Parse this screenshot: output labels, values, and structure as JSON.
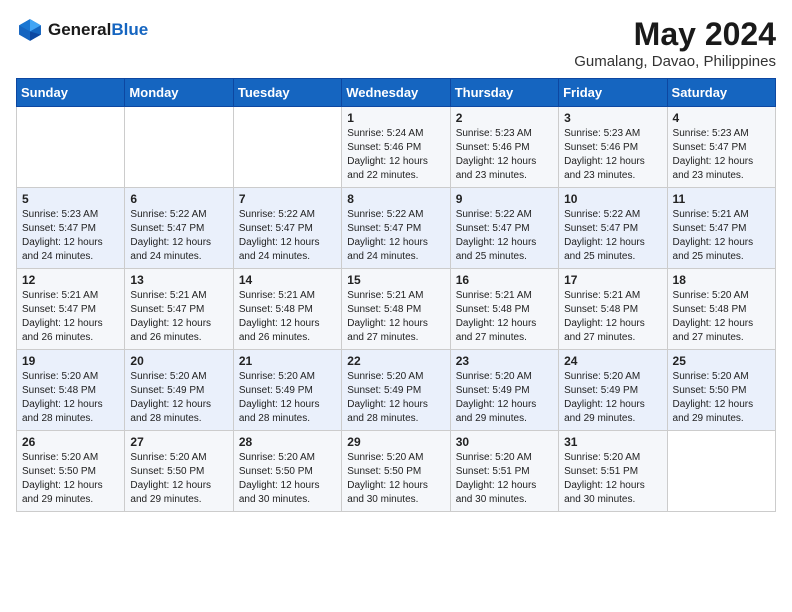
{
  "header": {
    "logo_general": "General",
    "logo_blue": "Blue",
    "month_year": "May 2024",
    "location": "Gumalang, Davao, Philippines"
  },
  "days_of_week": [
    "Sunday",
    "Monday",
    "Tuesday",
    "Wednesday",
    "Thursday",
    "Friday",
    "Saturday"
  ],
  "weeks": [
    [
      {
        "day": "",
        "info": ""
      },
      {
        "day": "",
        "info": ""
      },
      {
        "day": "",
        "info": ""
      },
      {
        "day": "1",
        "info": "Sunrise: 5:24 AM\nSunset: 5:46 PM\nDaylight: 12 hours\nand 22 minutes."
      },
      {
        "day": "2",
        "info": "Sunrise: 5:23 AM\nSunset: 5:46 PM\nDaylight: 12 hours\nand 23 minutes."
      },
      {
        "day": "3",
        "info": "Sunrise: 5:23 AM\nSunset: 5:46 PM\nDaylight: 12 hours\nand 23 minutes."
      },
      {
        "day": "4",
        "info": "Sunrise: 5:23 AM\nSunset: 5:47 PM\nDaylight: 12 hours\nand 23 minutes."
      }
    ],
    [
      {
        "day": "5",
        "info": "Sunrise: 5:23 AM\nSunset: 5:47 PM\nDaylight: 12 hours\nand 24 minutes."
      },
      {
        "day": "6",
        "info": "Sunrise: 5:22 AM\nSunset: 5:47 PM\nDaylight: 12 hours\nand 24 minutes."
      },
      {
        "day": "7",
        "info": "Sunrise: 5:22 AM\nSunset: 5:47 PM\nDaylight: 12 hours\nand 24 minutes."
      },
      {
        "day": "8",
        "info": "Sunrise: 5:22 AM\nSunset: 5:47 PM\nDaylight: 12 hours\nand 24 minutes."
      },
      {
        "day": "9",
        "info": "Sunrise: 5:22 AM\nSunset: 5:47 PM\nDaylight: 12 hours\nand 25 minutes."
      },
      {
        "day": "10",
        "info": "Sunrise: 5:22 AM\nSunset: 5:47 PM\nDaylight: 12 hours\nand 25 minutes."
      },
      {
        "day": "11",
        "info": "Sunrise: 5:21 AM\nSunset: 5:47 PM\nDaylight: 12 hours\nand 25 minutes."
      }
    ],
    [
      {
        "day": "12",
        "info": "Sunrise: 5:21 AM\nSunset: 5:47 PM\nDaylight: 12 hours\nand 26 minutes."
      },
      {
        "day": "13",
        "info": "Sunrise: 5:21 AM\nSunset: 5:47 PM\nDaylight: 12 hours\nand 26 minutes."
      },
      {
        "day": "14",
        "info": "Sunrise: 5:21 AM\nSunset: 5:48 PM\nDaylight: 12 hours\nand 26 minutes."
      },
      {
        "day": "15",
        "info": "Sunrise: 5:21 AM\nSunset: 5:48 PM\nDaylight: 12 hours\nand 27 minutes."
      },
      {
        "day": "16",
        "info": "Sunrise: 5:21 AM\nSunset: 5:48 PM\nDaylight: 12 hours\nand 27 minutes."
      },
      {
        "day": "17",
        "info": "Sunrise: 5:21 AM\nSunset: 5:48 PM\nDaylight: 12 hours\nand 27 minutes."
      },
      {
        "day": "18",
        "info": "Sunrise: 5:20 AM\nSunset: 5:48 PM\nDaylight: 12 hours\nand 27 minutes."
      }
    ],
    [
      {
        "day": "19",
        "info": "Sunrise: 5:20 AM\nSunset: 5:48 PM\nDaylight: 12 hours\nand 28 minutes."
      },
      {
        "day": "20",
        "info": "Sunrise: 5:20 AM\nSunset: 5:49 PM\nDaylight: 12 hours\nand 28 minutes."
      },
      {
        "day": "21",
        "info": "Sunrise: 5:20 AM\nSunset: 5:49 PM\nDaylight: 12 hours\nand 28 minutes."
      },
      {
        "day": "22",
        "info": "Sunrise: 5:20 AM\nSunset: 5:49 PM\nDaylight: 12 hours\nand 28 minutes."
      },
      {
        "day": "23",
        "info": "Sunrise: 5:20 AM\nSunset: 5:49 PM\nDaylight: 12 hours\nand 29 minutes."
      },
      {
        "day": "24",
        "info": "Sunrise: 5:20 AM\nSunset: 5:49 PM\nDaylight: 12 hours\nand 29 minutes."
      },
      {
        "day": "25",
        "info": "Sunrise: 5:20 AM\nSunset: 5:50 PM\nDaylight: 12 hours\nand 29 minutes."
      }
    ],
    [
      {
        "day": "26",
        "info": "Sunrise: 5:20 AM\nSunset: 5:50 PM\nDaylight: 12 hours\nand 29 minutes."
      },
      {
        "day": "27",
        "info": "Sunrise: 5:20 AM\nSunset: 5:50 PM\nDaylight: 12 hours\nand 29 minutes."
      },
      {
        "day": "28",
        "info": "Sunrise: 5:20 AM\nSunset: 5:50 PM\nDaylight: 12 hours\nand 30 minutes."
      },
      {
        "day": "29",
        "info": "Sunrise: 5:20 AM\nSunset: 5:50 PM\nDaylight: 12 hours\nand 30 minutes."
      },
      {
        "day": "30",
        "info": "Sunrise: 5:20 AM\nSunset: 5:51 PM\nDaylight: 12 hours\nand 30 minutes."
      },
      {
        "day": "31",
        "info": "Sunrise: 5:20 AM\nSunset: 5:51 PM\nDaylight: 12 hours\nand 30 minutes."
      },
      {
        "day": "",
        "info": ""
      }
    ]
  ]
}
